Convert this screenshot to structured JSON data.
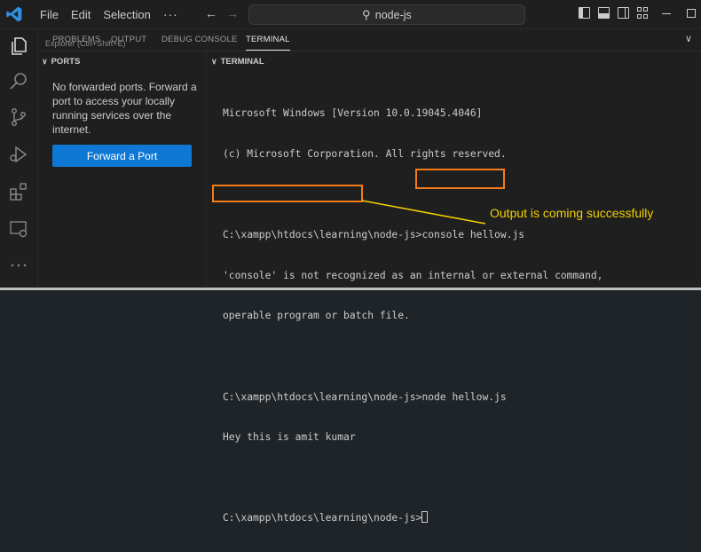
{
  "titlebar": {
    "menu": [
      "File",
      "Edit",
      "Selection",
      "···"
    ],
    "search": "node-js"
  },
  "panel": {
    "tabs": [
      "PROBLEMS",
      "OUTPUT",
      "DEBUG CONSOLE",
      "TERMINAL"
    ],
    "active_tab": "TERMINAL",
    "tooltip": "Explorer (Ctrl+Shift+E)"
  },
  "ports": {
    "header": "PORTS",
    "message": "No forwarded ports. Forward a port to access your locally running services over the internet.",
    "button": "Forward a Port"
  },
  "terminal": {
    "header": "TERMINAL",
    "lines": [
      "Microsoft Windows [Version 10.0.19045.4046]",
      "(c) Microsoft Corporation. All rights reserved.",
      "",
      "C:\\xampp\\htdocs\\learning\\node-js>console hellow.js",
      "'console' is not recognized as an internal or external command,",
      "operable program or batch file.",
      "",
      "C:\\xampp\\htdocs\\learning\\node-js>node hellow.js",
      "Hey this is amit kumar",
      "",
      "C:\\xampp\\htdocs\\learning\\node-js>"
    ]
  },
  "annotation": {
    "text": "Output is coming successfully",
    "color": "#f0d000",
    "box_color": "#f57c16"
  }
}
